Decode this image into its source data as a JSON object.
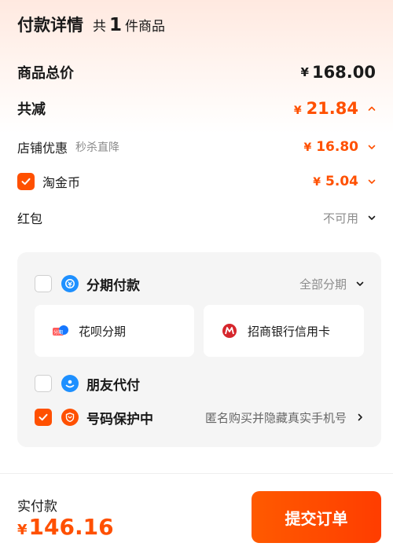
{
  "header": {
    "title": "付款详情",
    "count_prefix": "共",
    "count": "1",
    "count_suffix": "件商品"
  },
  "summary": {
    "total": {
      "label": "商品总价",
      "currency": "¥",
      "amount": "168.00"
    },
    "discount": {
      "label": "共减",
      "currency": "¥",
      "amount": "21.84",
      "expanded": true
    },
    "shop_discount": {
      "label": "店铺优惠",
      "sublabel": "秒杀直降",
      "currency": "¥",
      "amount": "16.80"
    },
    "taojinbi": {
      "label": "淘金币",
      "checked": true,
      "currency": "¥",
      "amount": "5.04"
    },
    "hongbao": {
      "label": "红包",
      "status": "不可用"
    }
  },
  "panel": {
    "installment": {
      "label": "分期付款",
      "checked": false,
      "action": "全部分期"
    },
    "options": [
      {
        "label": "花呗分期",
        "icon": "huabei-icon"
      },
      {
        "label": "招商银行信用卡",
        "icon": "cmb-bank-icon"
      }
    ],
    "friend_pay": {
      "label": "朋友代付",
      "checked": false
    },
    "number_protect": {
      "label": "号码保护中",
      "checked": true,
      "desc": "匿名购买并隐藏真实手机号"
    }
  },
  "footer": {
    "label": "实付款",
    "currency": "¥",
    "amount": "146.16",
    "submit_label": "提交订单"
  },
  "colors": {
    "accent": "#ff5000",
    "installment_icon": "#1677ff",
    "friend_icon": "#1677ff",
    "protect_icon": "#ff5000"
  }
}
